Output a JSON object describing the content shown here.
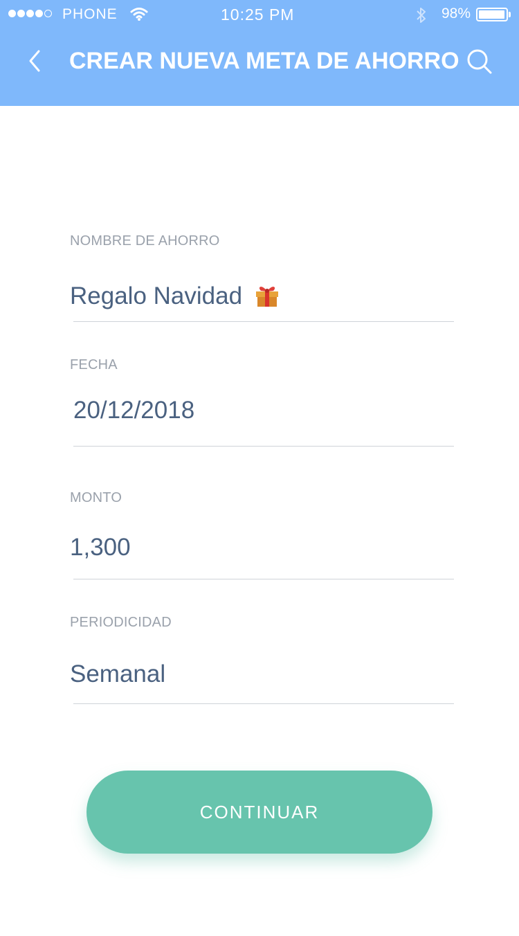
{
  "status_bar": {
    "carrier": "PHONE",
    "time": "10:25 PM",
    "battery_percent": "98%",
    "battery_level": 0.98,
    "signal_bars_filled": 4,
    "signal_bars_total": 5
  },
  "nav": {
    "title": "CREAR NUEVA META DE AHORRO",
    "back_icon": "chevron-left-icon",
    "search_icon": "search-icon",
    "background_color": "#7fb8fb"
  },
  "form": {
    "name_label": "NOMBRE DE AHORRO",
    "name_value": "Regalo Navidad",
    "name_emoji_icon": "gift-icon",
    "date_label": "FECHA",
    "date_value": "20/12/2018",
    "amount_label": "MONTO",
    "amount_value": "1,300",
    "period_label": "PERIODICIDAD",
    "period_value": "Semanal"
  },
  "actions": {
    "continue_label": "CONTINUAR",
    "continue_color": "#67c4ad"
  }
}
